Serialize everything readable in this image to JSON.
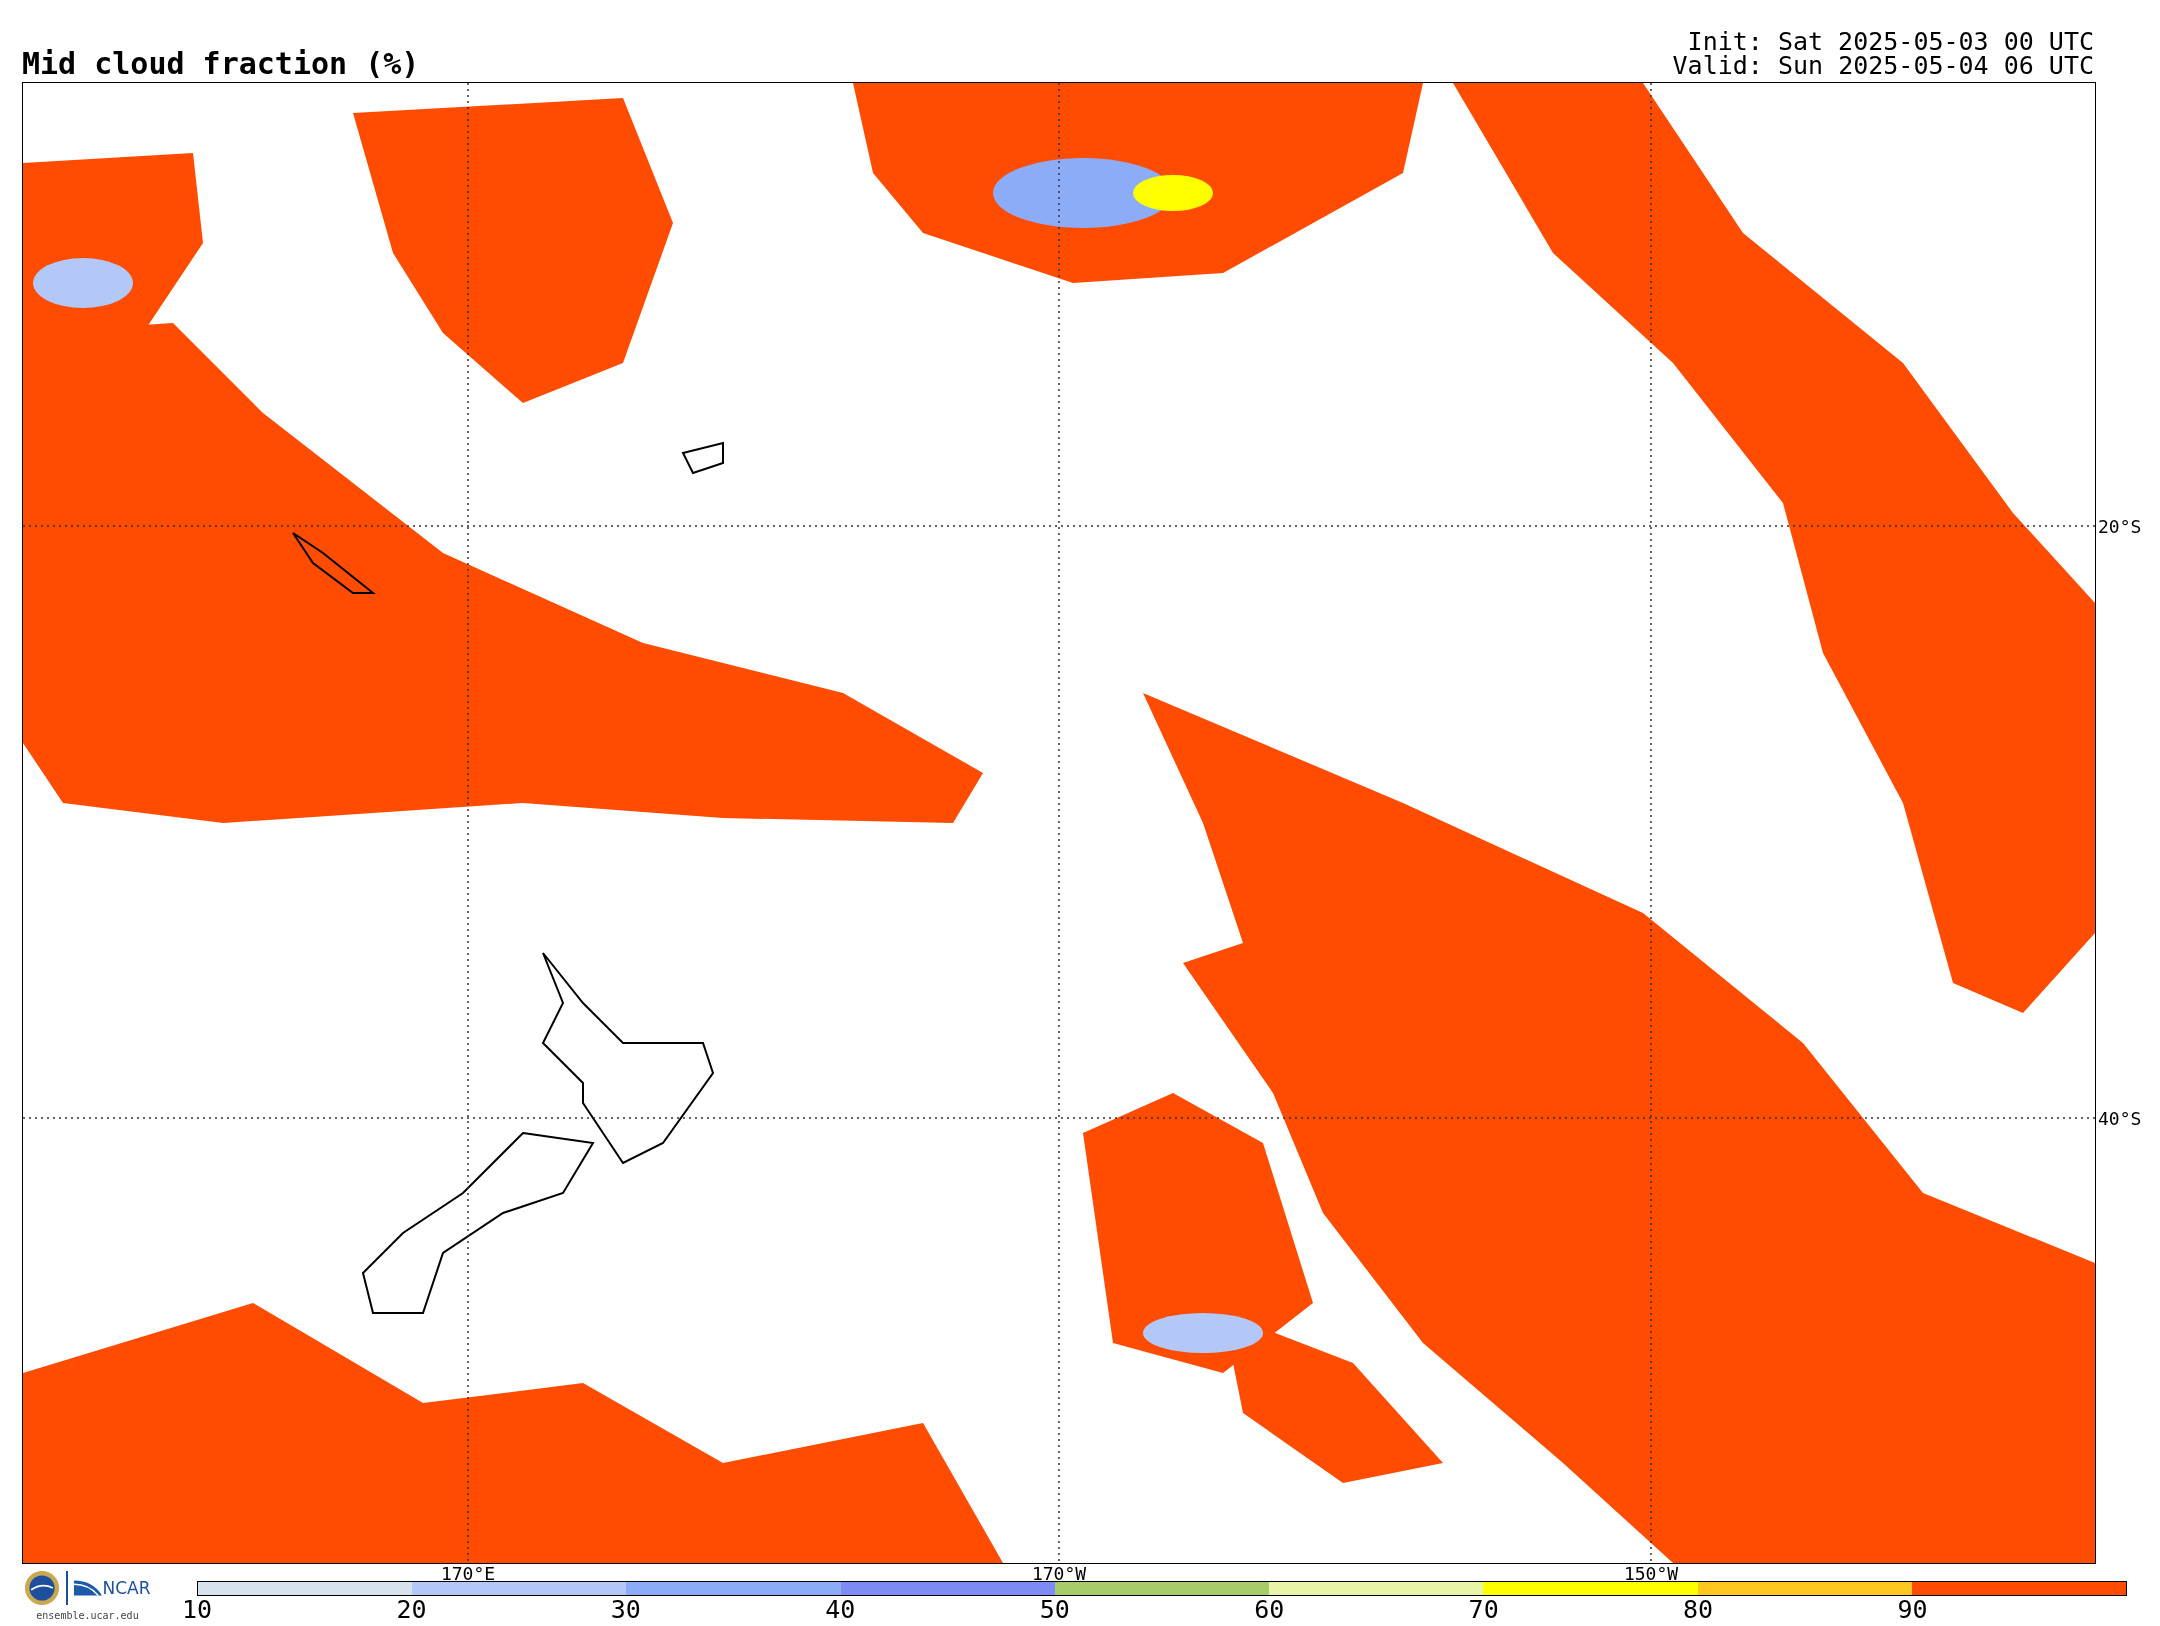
{
  "title": "Mid cloud fraction (%)",
  "init": "Init: Sat 2025-05-03 00 UTC",
  "valid": "Valid: Sun 2025-05-04 06 UTC",
  "map": {
    "latitude_labels": [
      "20°S",
      "40°S"
    ],
    "longitude_labels": [
      "170°E",
      "170°W",
      "150°W"
    ]
  },
  "logos": {
    "ncar": "NCAR",
    "website": "ensemble.ucar.edu"
  },
  "colorbar": {
    "bins": [
      {
        "color": "#d6e2ec"
      },
      {
        "color": "#b4c8f8"
      },
      {
        "color": "#8cacf8"
      },
      {
        "color": "#7c8cf4"
      },
      {
        "color": "#a8cc6c"
      },
      {
        "color": "#e8f4a8"
      },
      {
        "color": "#ffff00"
      },
      {
        "color": "#ffc820"
      },
      {
        "color": "#ff4c00"
      }
    ],
    "tick_labels": [
      "10",
      "20",
      "30",
      "40",
      "50",
      "60",
      "70",
      "80",
      "90"
    ]
  }
}
